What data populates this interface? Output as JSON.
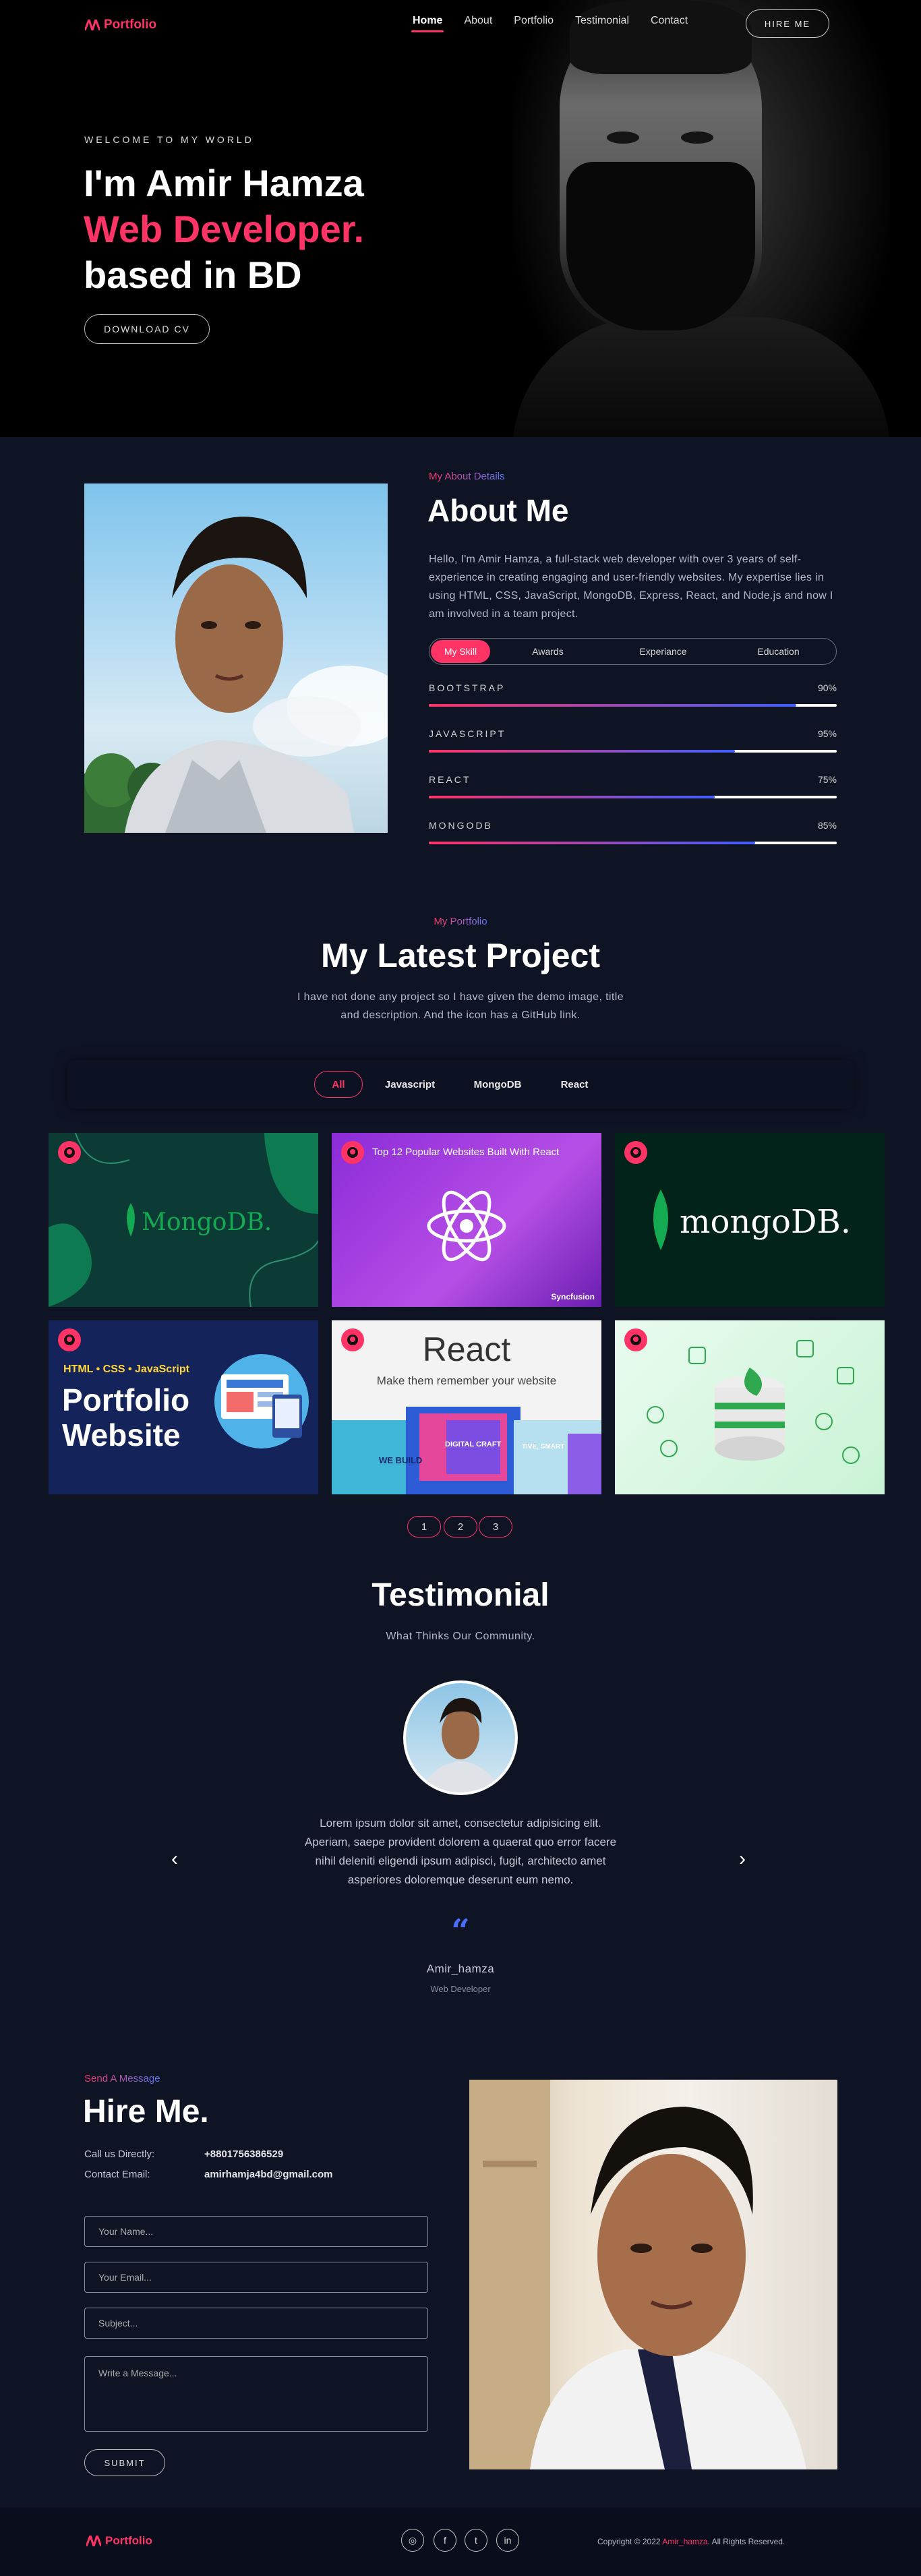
{
  "brand": {
    "name": "Portfolio",
    "accent": "#ff3366",
    "secondary": "#4060ff"
  },
  "nav": {
    "items": [
      "Home",
      "About",
      "Portfolio",
      "Testimonial",
      "Contact"
    ],
    "active": "Home",
    "hire_label": "HIRE ME"
  },
  "hero": {
    "welcome": "WELCOME TO MY WORLD",
    "line1": "I'm Amir Hamza",
    "line2": "Web Developer.",
    "line3": "based in BD",
    "download_label": "DOWNLOAD CV"
  },
  "about": {
    "subtitle": "My About Details",
    "title": "About Me",
    "text": "Hello, I'm Amir Hamza, a full-stack web developer with over 3 years of self-experience in creating engaging and user-friendly websites. My expertise lies in using HTML, CSS, JavaScript, MongoDB, Express, React, and Node.js and now I am involved in a team project.",
    "tabs": [
      "My Skill",
      "Awards",
      "Experiance",
      "Education"
    ],
    "active_tab": "My Skill",
    "skills": [
      {
        "name": "BOOTSTRAP",
        "label": "90%",
        "value": 0.9
      },
      {
        "name": "JAVASCRIPT",
        "label": "95%",
        "value": 0.75
      },
      {
        "name": "REACT",
        "label": "75%",
        "value": 0.7
      },
      {
        "name": "MONGODB",
        "label": "85%",
        "value": 0.8
      }
    ]
  },
  "portfolio": {
    "subtitle": "My Portfolio",
    "title": "My Latest Project",
    "description_line1": "I have not done any project so I have given the demo image, title",
    "description_line2": "and description. And the icon has a GitHub link.",
    "filters": [
      "All",
      "Javascript",
      "MongoDB",
      "React"
    ],
    "active_filter": "All",
    "cards": [
      {
        "text": "MongoDB."
      },
      {
        "text": "Top 12 Popular Websites Built With React",
        "bold": "React",
        "tag": "Syncfusion"
      },
      {
        "text": "mongoDB."
      },
      {
        "top": "HTML • CSS • JavaScript",
        "title1": "Portfolio",
        "title2": "Website"
      },
      {
        "title": "React",
        "sub": "Make them remember your website",
        "b1": "WE BUILD",
        "b2": "DIGITAL CRAFT",
        "b3": "TIVE, SMART"
      },
      {
        "text": ""
      }
    ],
    "pages": [
      "1",
      "2",
      "3"
    ]
  },
  "testimonial": {
    "title": "Testimonial",
    "subtitle": "What Thinks Our Community.",
    "text_line1": "Lorem ipsum dolor sit amet, consectetur adipisicing elit.",
    "text_line2": "Aperiam, saepe provident dolorem a quaerat quo error facere",
    "text_line3": "nihil deleniti eligendi ipsum adipisci, fugit, architecto amet",
    "text_line4": "asperiores doloremque deserunt eum nemo.",
    "quote_mark": "“",
    "name": "Amir_hamza",
    "role": "Web Developer"
  },
  "contact": {
    "subtitle": "Send A Message",
    "title": "Hire Me.",
    "phone_label": "Call us Directly:",
    "phone": "+8801756386529",
    "email_label": "Contact Email:",
    "email": "amirhamja4bd@gmail.com",
    "placeholders": {
      "name": "Your Name...",
      "email": "Your Email...",
      "subject": "Subject...",
      "message": "Write a Message..."
    },
    "submit_label": "SUBMIT"
  },
  "footer": {
    "copyright_prefix": "Copyright © 2022",
    "copyright_name": "Amir_hamza",
    "copyright_suffix": ". All Rights Reserved.",
    "social": [
      "instagram-icon",
      "facebook-icon",
      "twitter-icon",
      "linkedin-icon"
    ]
  }
}
